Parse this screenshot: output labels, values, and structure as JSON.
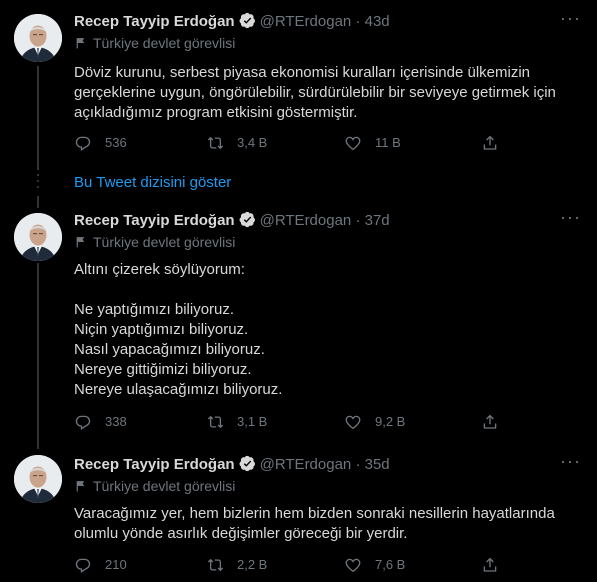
{
  "tweets": [
    {
      "name": "Recep Tayyip Erdoğan",
      "handle": "@RTErdogan · 43d",
      "label": "Türkiye devlet görevlisi",
      "lines": [
        "Döviz kurunu, serbest piyasa ekonomisi kuralları içerisinde ülkemizin",
        "gerçeklerine uygun, öngörülebilir, sürdürülebilir bir seviyeye getirmek için",
        "açıkladığımız program etkisini göstermiştir."
      ],
      "replies": "536",
      "retweets": "3,4 B",
      "likes": "11 B"
    },
    {
      "name": "Recep Tayyip Erdoğan",
      "handle": "@RTErdogan · 37d",
      "label": "Türkiye devlet görevlisi",
      "lines": [
        "Altını çizerek söylüyorum:",
        "",
        "Ne yaptığımızı biliyoruz.",
        "Niçin yaptığımızı biliyoruz.",
        "Nasıl yapacağımızı biliyoruz.",
        "Nereye gittiğimizi biliyoruz.",
        "Nereye ulaşacağımızı biliyoruz."
      ],
      "replies": "338",
      "retweets": "3,1 B",
      "likes": "9,2 B"
    },
    {
      "name": "Recep Tayyip Erdoğan",
      "handle": "@RTErdogan · 35d",
      "label": "Türkiye devlet görevlisi",
      "lines": [
        "Varacağımız yer, hem bizlerin hem bizden sonraki nesillerin hayatlarında",
        "olumlu yönde asırlık değişimler göreceği bir yerdir."
      ],
      "replies": "210",
      "retweets": "2,2 B",
      "likes": "7,6 B"
    }
  ],
  "show_thread": "Bu Tweet dizisini göster",
  "colors": {
    "background": "#000000",
    "text": "#d9d9d9",
    "muted": "#6e767d",
    "link": "#1d9bf0",
    "verified": "#d9d9d9"
  },
  "icons": [
    "verified-badge-icon",
    "flag-icon",
    "more-icon",
    "reply-icon",
    "retweet-icon",
    "like-icon",
    "share-icon"
  ]
}
